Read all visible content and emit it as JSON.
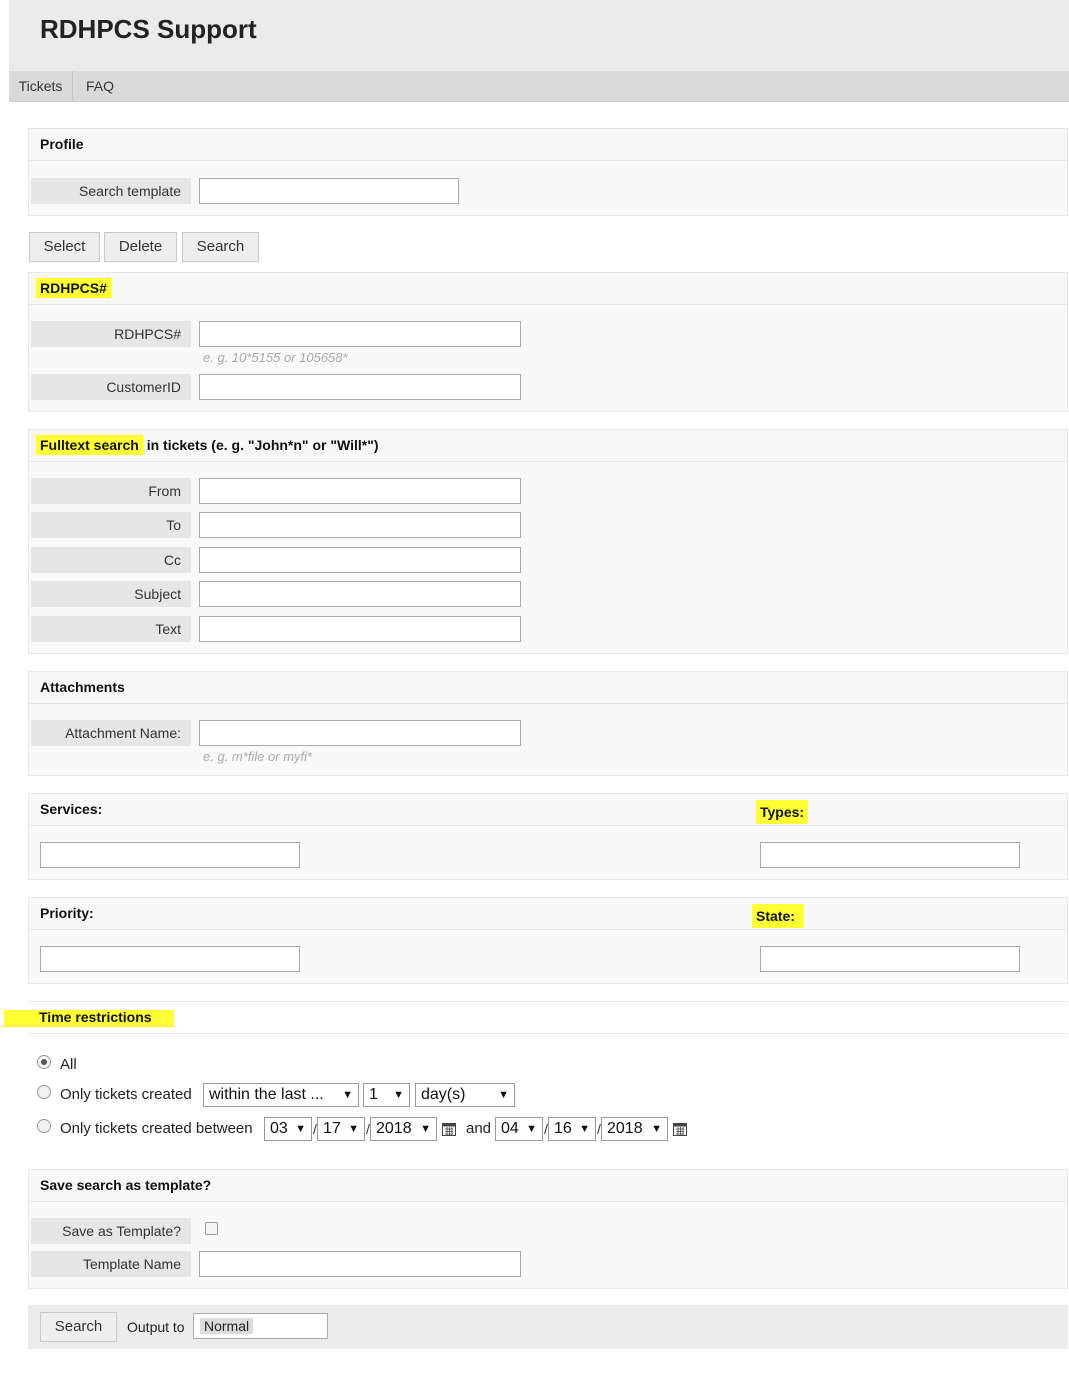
{
  "app": {
    "title": "RDHPCS Support"
  },
  "nav": {
    "tickets": "Tickets",
    "faq": "FAQ"
  },
  "profile": {
    "heading": "Profile",
    "search_template_label": "Search template",
    "search_template_value": ""
  },
  "profile_buttons": {
    "select": "Select",
    "delete": "Delete",
    "search": "Search"
  },
  "rdhpcs": {
    "heading": "RDHPCS#",
    "number_label": "RDHPCS#",
    "number_hint": "e. g. 10*5155 or 105658*",
    "customer_label": "CustomerID"
  },
  "fulltext": {
    "heading_highlight": "Fulltext search",
    "heading_rest": " in tickets (e. g. \"John*n\" or \"Will*\")",
    "fields": [
      "From",
      "To",
      "Cc",
      "Subject",
      "Text"
    ]
  },
  "attachments": {
    "heading": "Attachments",
    "name_label": "Attachment Name:",
    "name_hint": "e. g. m*file or myfi*"
  },
  "services_types": {
    "services": "Services:",
    "types": "Types:"
  },
  "priority_state": {
    "priority": "Priority:",
    "state": "State:"
  },
  "time": {
    "heading": "Time restrictions",
    "all": "All",
    "created": "Only tickets created",
    "created_within": "within the last ...",
    "created_amount": "1",
    "created_unit": "day(s)",
    "between": "Only tickets created between",
    "from_month": "03",
    "from_day": "17",
    "from_year": "2018",
    "and": "and",
    "to_month": "04",
    "to_day": "16",
    "to_year": "2018",
    "slash": "/",
    "selected": "All"
  },
  "save": {
    "heading": "Save search as template?",
    "save_label": "Save as Template?",
    "name_label": "Template Name"
  },
  "footer": {
    "search": "Search",
    "output_label": "Output to",
    "output_value": "Normal"
  },
  "colors": {
    "highlight": "#ffff33",
    "panel": "#f9f9f9",
    "label_bg": "#e6e6e6"
  }
}
